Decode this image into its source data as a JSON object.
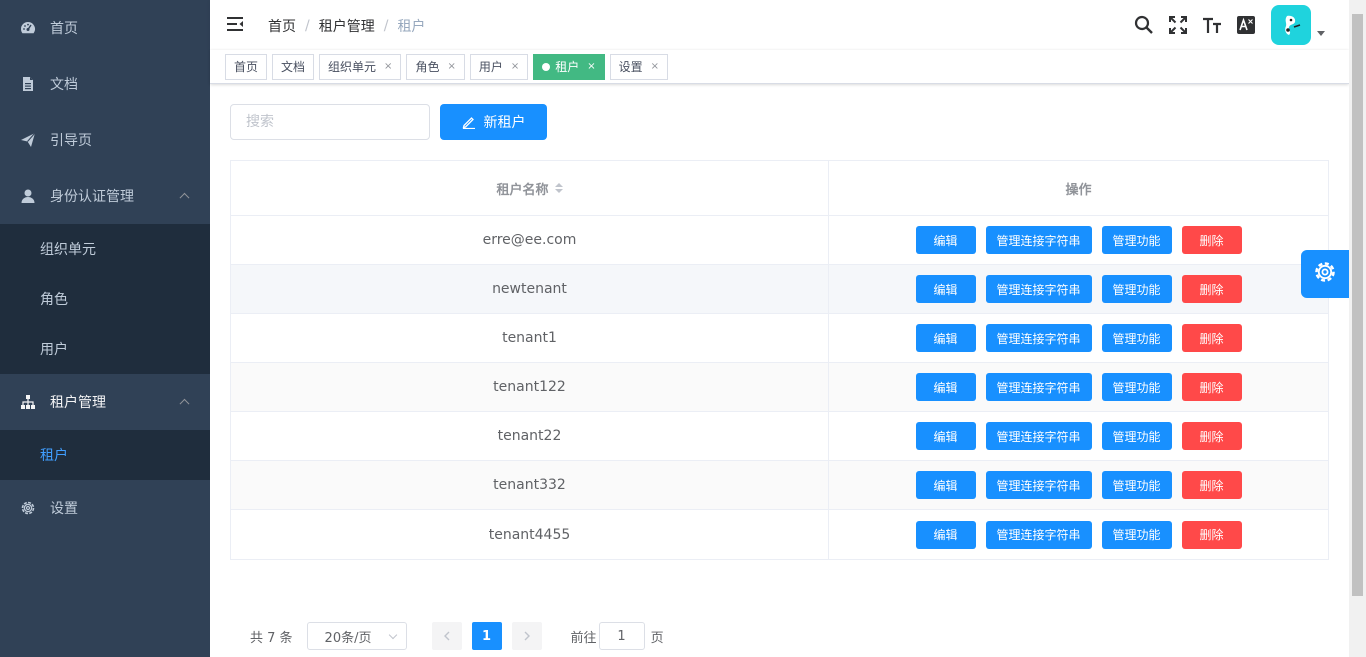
{
  "sidebar": {
    "items": [
      {
        "label": "首页",
        "icon": "dashboard-icon"
      },
      {
        "label": "文档",
        "icon": "document-icon"
      },
      {
        "label": "引导页",
        "icon": "guide-icon"
      },
      {
        "label": "身份认证管理",
        "icon": "user-icon"
      },
      {
        "label": "租户管理",
        "icon": "tree-icon"
      },
      {
        "label": "设置",
        "icon": "gear-icon"
      }
    ],
    "identity_sub": [
      "组织单元",
      "角色",
      "用户"
    ],
    "tenant_sub": [
      "租户"
    ]
  },
  "breadcrumb": [
    "首页",
    "租户管理",
    "租户"
  ],
  "breadcrumb_sep": "/",
  "tags": [
    {
      "label": "首页",
      "closable": false
    },
    {
      "label": "文档",
      "closable": false
    },
    {
      "label": "组织单元",
      "closable": true
    },
    {
      "label": "角色",
      "closable": true
    },
    {
      "label": "用户",
      "closable": true
    },
    {
      "label": "租户",
      "closable": true,
      "active": true
    },
    {
      "label": "设置",
      "closable": true
    }
  ],
  "tag_close": "×",
  "toolbar": {
    "search_placeholder": "搜索",
    "new_button": "新租户"
  },
  "table": {
    "headers": [
      "租户名称",
      "操作"
    ],
    "rows": [
      "erre@ee.com",
      "newtenant",
      "tenant1",
      "tenant122",
      "tenant22",
      "tenant332",
      "tenant4455"
    ],
    "actions": {
      "edit": "编辑",
      "conn": "管理连接字符串",
      "feature": "管理功能",
      "delete": "删除"
    }
  },
  "pagination": {
    "total": "共 7 条",
    "page_size": "20条/页",
    "current": "1",
    "goto_prefix": "前往",
    "goto_value": "1",
    "goto_suffix": "页"
  },
  "colors": {
    "sidebar_bg": "#304156",
    "submenu_bg": "#1f2d3d",
    "primary": "#1890ff",
    "danger": "#ff4949",
    "tag_active": "#42b983",
    "avatar_bg": "#1fd3dd"
  }
}
